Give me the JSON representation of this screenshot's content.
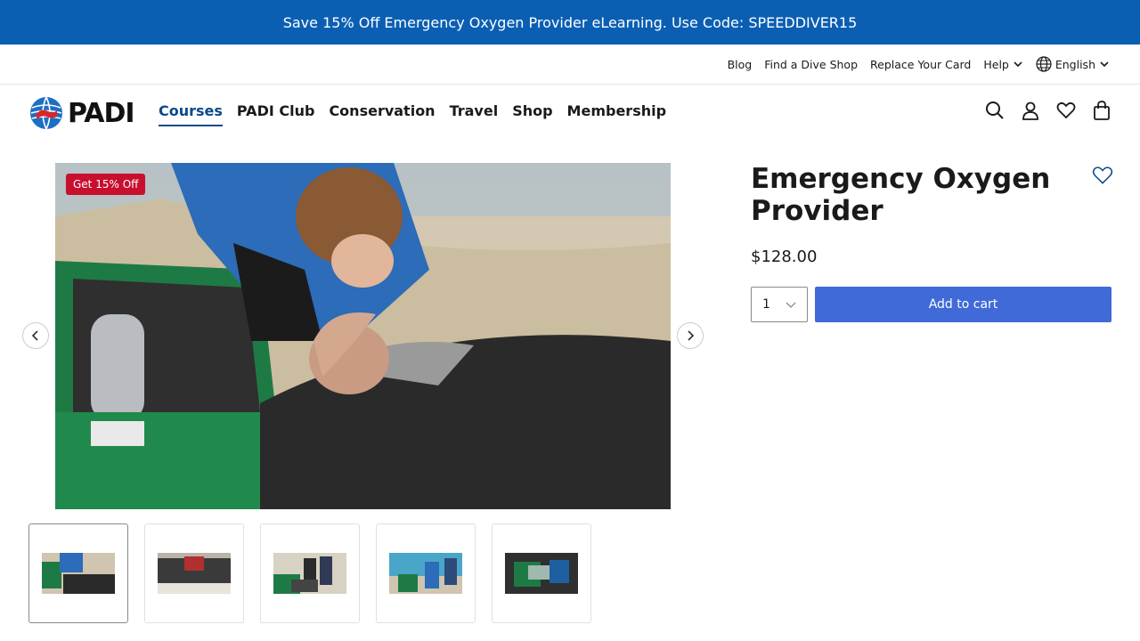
{
  "promo": {
    "text": "Save 15% Off Emergency Oxygen Provider eLearning. Use Code: SPEEDDIVER15"
  },
  "utility": {
    "blog": "Blog",
    "find_shop": "Find a Dive Shop",
    "replace_card": "Replace Your Card",
    "help": "Help",
    "language": "English"
  },
  "brand": {
    "logo_text": "PADI"
  },
  "nav": {
    "items": [
      {
        "label": "Courses",
        "active": true
      },
      {
        "label": "PADI Club"
      },
      {
        "label": "Conservation"
      },
      {
        "label": "Travel"
      },
      {
        "label": "Shop"
      },
      {
        "label": "Membership"
      }
    ]
  },
  "icons": [
    "search-icon",
    "account-icon",
    "heart-icon",
    "bag-icon"
  ],
  "product": {
    "badge": "Get 15% Off",
    "title": "Emergency Oxygen Provider",
    "price": "$128.00",
    "quantity": "1",
    "add_to_cart": "Add to cart"
  },
  "colors": {
    "promo_bg": "#0a5fb2",
    "badge": "#c8102e",
    "cart_button": "#3f6ad8",
    "active_nav": "#0a4a8a"
  }
}
